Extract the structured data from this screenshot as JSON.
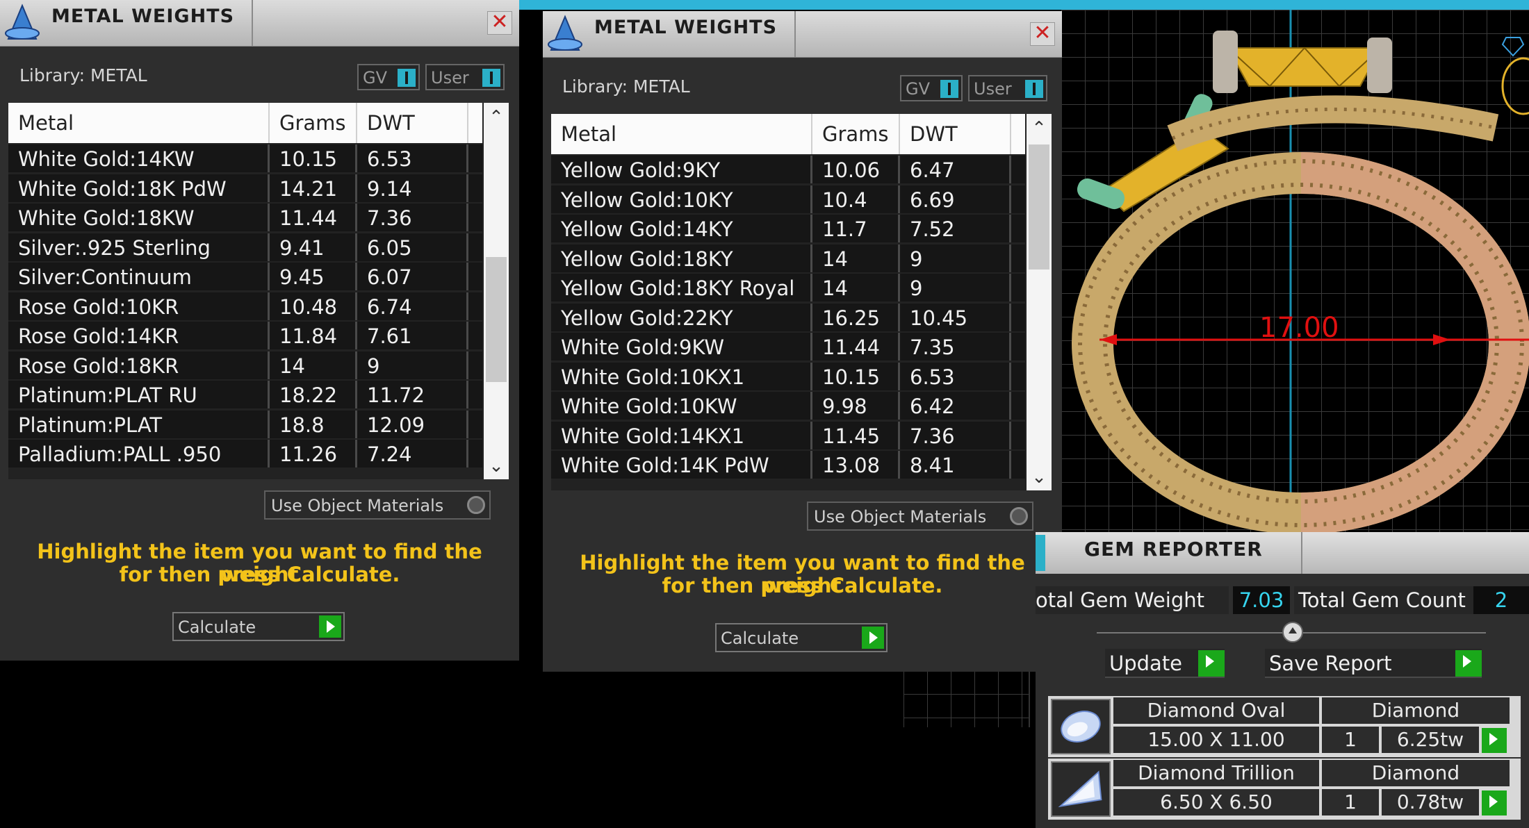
{
  "panel_left": {
    "title": "METAL WEIGHTS",
    "library_label": "Library: METAL",
    "toggle_gv": "GV",
    "toggle_user": "User",
    "columns": [
      "Metal",
      "Grams",
      "DWT"
    ],
    "rows": [
      [
        "White Gold:14KW",
        "10.15",
        "6.53"
      ],
      [
        "White Gold:18K PdW",
        "14.21",
        "9.14"
      ],
      [
        "White Gold:18KW",
        "11.44",
        "7.36"
      ],
      [
        "Silver:.925 Sterling",
        "9.41",
        "6.05"
      ],
      [
        "Silver:Continuum",
        "9.45",
        "6.07"
      ],
      [
        "Rose Gold:10KR",
        "10.48",
        "6.74"
      ],
      [
        "Rose Gold:14KR",
        "11.84",
        "7.61"
      ],
      [
        "Rose Gold:18KR",
        "14",
        "9"
      ],
      [
        "Platinum:PLAT RU",
        "18.22",
        "11.72"
      ],
      [
        "Platinum:PLAT",
        "18.8",
        "12.09"
      ],
      [
        "Palladium:PALL .950",
        "11.26",
        "7.24"
      ]
    ],
    "use_object_materials": "Use Object Materials",
    "hint_line1": "Highlight the item you want to find the weight",
    "hint_line2": "for then press Calculate.",
    "calculate": "Calculate"
  },
  "panel_right": {
    "title": "METAL WEIGHTS",
    "library_label": "Library: METAL",
    "toggle_gv": "GV",
    "toggle_user": "User",
    "columns": [
      "Metal",
      "Grams",
      "DWT"
    ],
    "rows": [
      [
        "Yellow Gold:9KY",
        "10.06",
        "6.47"
      ],
      [
        "Yellow Gold:10KY",
        "10.4",
        "6.69"
      ],
      [
        "Yellow Gold:14KY",
        "11.7",
        "7.52"
      ],
      [
        "Yellow Gold:18KY",
        "14",
        "9"
      ],
      [
        "Yellow Gold:18KY Royal",
        "14",
        "9"
      ],
      [
        "Yellow Gold:22KY",
        "16.25",
        "10.45"
      ],
      [
        "White Gold:9KW",
        "11.44",
        "7.35"
      ],
      [
        "White Gold:10KX1",
        "10.15",
        "6.53"
      ],
      [
        "White Gold:10KW",
        "9.98",
        "6.42"
      ],
      [
        "White Gold:14KX1",
        "11.45",
        "7.36"
      ],
      [
        "White Gold:14K PdW",
        "13.08",
        "8.41"
      ]
    ],
    "use_object_materials": "Use Object Materials",
    "hint_line1": "Highlight the item you want to find the weight",
    "hint_line2": "for then press Calculate.",
    "calculate": "Calculate"
  },
  "viewport": {
    "dimension_label": "17.00"
  },
  "gem_reporter": {
    "title": "GEM REPORTER",
    "total_weight_label": "otal Gem Weight",
    "total_weight_value": "7.03",
    "total_count_label": "Total Gem Count",
    "total_count_value": "2",
    "update": "Update",
    "save_report": "Save Report",
    "gems": [
      {
        "name": "Diamond Oval",
        "material": "Diamond",
        "size": "15.00 X 11.00",
        "qty": "1",
        "weight": "6.25tw"
      },
      {
        "name": "Diamond Trillion",
        "material": "Diamond",
        "size": "6.50 X 6.50",
        "qty": "1",
        "weight": "0.78tw"
      }
    ]
  }
}
